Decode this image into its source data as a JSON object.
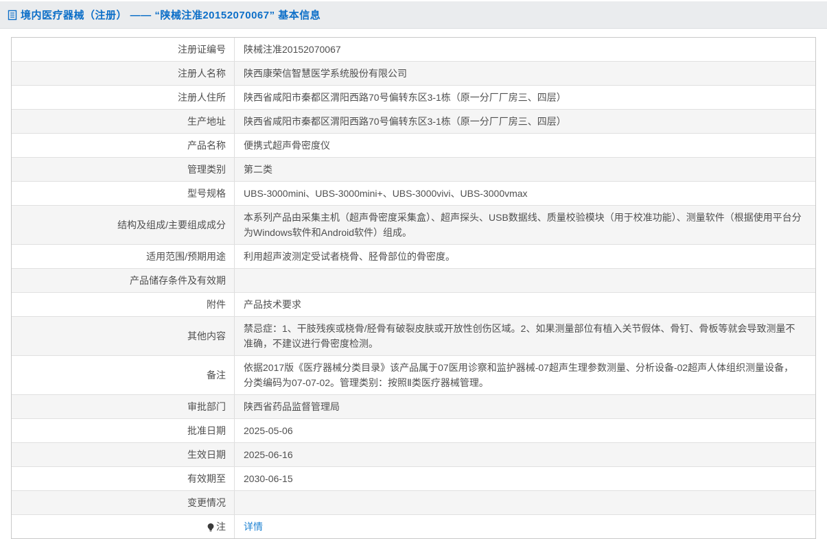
{
  "header": {
    "title": "境内医疗器械（注册） —— “陕械注准20152070067” 基本信息"
  },
  "colors": {
    "title_blue": "#0d6fc8",
    "link_blue": "#1e82d2",
    "stripe_gray": "#f5f5f5"
  },
  "table": {
    "rows": [
      {
        "label": "注册证编号",
        "value": "陕械注准20152070067"
      },
      {
        "label": "注册人名称",
        "value": "陕西康荣信智慧医学系统股份有限公司"
      },
      {
        "label": "注册人住所",
        "value": "陕西省咸阳市秦都区渭阳西路70号偏转东区3-1栋（原一分厂厂房三、四层）"
      },
      {
        "label": "生产地址",
        "value": "陕西省咸阳市秦都区渭阳西路70号偏转东区3-1栋（原一分厂厂房三、四层）"
      },
      {
        "label": "产品名称",
        "value": "便携式超声骨密度仪"
      },
      {
        "label": "管理类别",
        "value": "第二类"
      },
      {
        "label": "型号规格",
        "value": "UBS-3000mini、UBS-3000mini+、UBS-3000vivi、UBS-3000vmax"
      },
      {
        "label": "结构及组成/主要组成成分",
        "value": "本系列产品由采集主机（超声骨密度采集盒）、超声探头、USB数据线、质量校验模块（用于校准功能）、测量软件（根据使用平台分为Windows软件和Android软件）组成。"
      },
      {
        "label": "适用范围/预期用途",
        "value": "利用超声波测定受试者桡骨、胫骨部位的骨密度。"
      },
      {
        "label": "产品储存条件及有效期",
        "value": ""
      },
      {
        "label": "附件",
        "value": "产品技术要求"
      },
      {
        "label": "其他内容",
        "value": "禁忌症：1、干肢残疾或桡骨/胫骨有破裂皮肤或开放性创伤区域。2、如果测量部位有植入关节假体、骨钉、骨板等就会导致测量不准确，不建议进行骨密度检测。"
      },
      {
        "label": "备注",
        "value": "依据2017版《医疗器械分类目录》该产品属于07医用诊察和监护器械-07超声生理参数测量、分析设备-02超声人体组织测量设备，分类编码为07-07-02。管理类别：按照Ⅱ类医疗器械管理。"
      },
      {
        "label": "审批部门",
        "value": "陕西省药品监督管理局"
      },
      {
        "label": "批准日期",
        "value": "2025-05-06"
      },
      {
        "label": "生效日期",
        "value": "2025-06-16"
      },
      {
        "label": "有效期至",
        "value": "2030-06-15"
      },
      {
        "label": "变更情况",
        "value": ""
      },
      {
        "label": "注",
        "value": "详情"
      }
    ]
  }
}
